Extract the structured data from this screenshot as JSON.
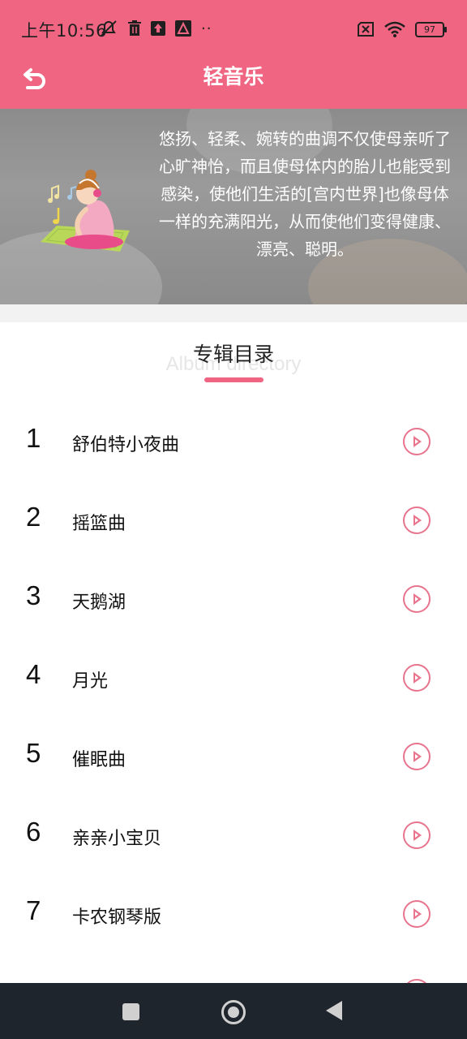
{
  "status_bar": {
    "time": "上午10:56",
    "battery": "97",
    "icons_left": [
      "mute-icon",
      "trash-icon",
      "upload-icon",
      "app-icon",
      "more-dots-icon"
    ],
    "icons_right": [
      "no-sim-icon",
      "wifi-icon",
      "battery-icon"
    ]
  },
  "app_bar": {
    "title": "轻音乐",
    "back_icon": "back-arrow-icon"
  },
  "banner": {
    "text": "悠扬、轻柔、婉转的曲调不仅使母亲听了心旷神怡，而且使母体内的胎儿也能受到感染，使他们生活的[宫内世界]也像母体一样的充满阳光，从而使他们变得健康、漂亮、聪明。",
    "illustration": "pregnant-woman-music-illustration"
  },
  "section": {
    "title": "专辑目录",
    "subtitle": "Album directory"
  },
  "tracks": [
    {
      "num": "1",
      "name": "舒伯特小夜曲"
    },
    {
      "num": "2",
      "name": "摇篮曲"
    },
    {
      "num": "3",
      "name": "天鹅湖"
    },
    {
      "num": "4",
      "name": "月光"
    },
    {
      "num": "5",
      "name": "催眠曲"
    },
    {
      "num": "6",
      "name": "亲亲小宝贝"
    },
    {
      "num": "7",
      "name": "卡农钢琴版"
    }
  ],
  "colors": {
    "primary": "#f06682",
    "play_icon": "#e8748d",
    "nav_bar": "#1f252c"
  },
  "nav_bar": {
    "buttons": [
      "recent-apps-icon",
      "home-icon",
      "back-icon"
    ]
  }
}
